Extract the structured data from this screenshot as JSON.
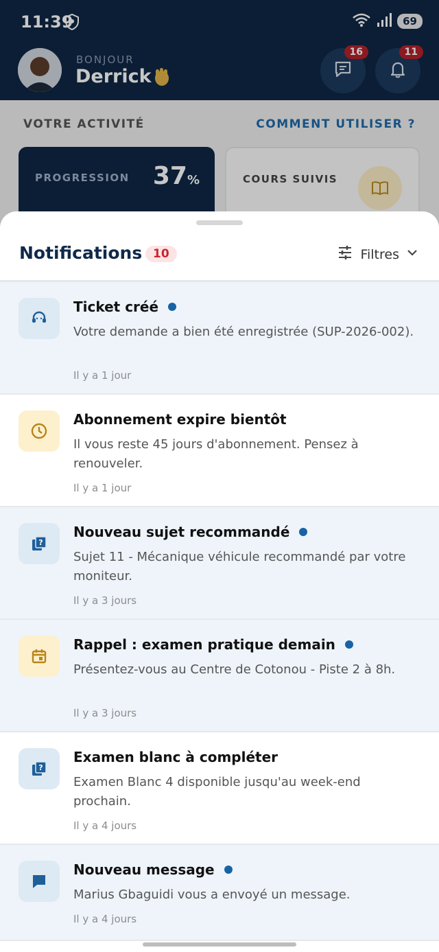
{
  "status_bar": {
    "time": "11:39",
    "battery": "69"
  },
  "header": {
    "greeting": "BONJOUR",
    "user_name": "Derrick",
    "messages_badge": "16",
    "notifications_badge": "11"
  },
  "activity": {
    "title": "VOTRE ACTIVITÉ",
    "help_link": "COMMENT UTILISER ?",
    "progress_label": "PROGRESSION",
    "progress_value": "37",
    "progress_unit": "%",
    "courses_label": "COURS SUIVIS"
  },
  "notifications": {
    "title": "Notifications",
    "count": "10",
    "filter_label": "Filtres",
    "items": [
      {
        "title": "Ticket créé",
        "desc": "Votre demande a bien été enregistrée (SUP-2026-002).",
        "time": "Il y a 1 jour",
        "unread": true,
        "icon": "support-agent-icon"
      },
      {
        "title": "Abonnement expire bientôt",
        "desc": "Il vous reste 45 jours d'abonnement. Pensez à renouveler.",
        "time": "Il y a 1 jour",
        "unread": false,
        "icon": "clock-icon"
      },
      {
        "title": "Nouveau sujet recommandé",
        "desc": "Sujet 11 - Mécanique véhicule recommandé par votre moniteur.",
        "time": "Il y a 3 jours",
        "unread": true,
        "icon": "quiz-icon"
      },
      {
        "title": "Rappel : examen pratique demain",
        "desc": "Présentez-vous au Centre de Cotonou - Piste 2 à 8h.",
        "time": "Il y a 3 jours",
        "unread": true,
        "icon": "calendar-icon"
      },
      {
        "title": "Examen blanc à compléter",
        "desc": "Examen Blanc 4 disponible jusqu'au week-end prochain.",
        "time": "Il y a 4 jours",
        "unread": false,
        "icon": "quiz-icon"
      },
      {
        "title": "Nouveau message",
        "desc": "Marius Gbaguidi vous a envoyé un message.",
        "time": "Il y a 4 jours",
        "unread": true,
        "icon": "chat-icon"
      }
    ]
  }
}
